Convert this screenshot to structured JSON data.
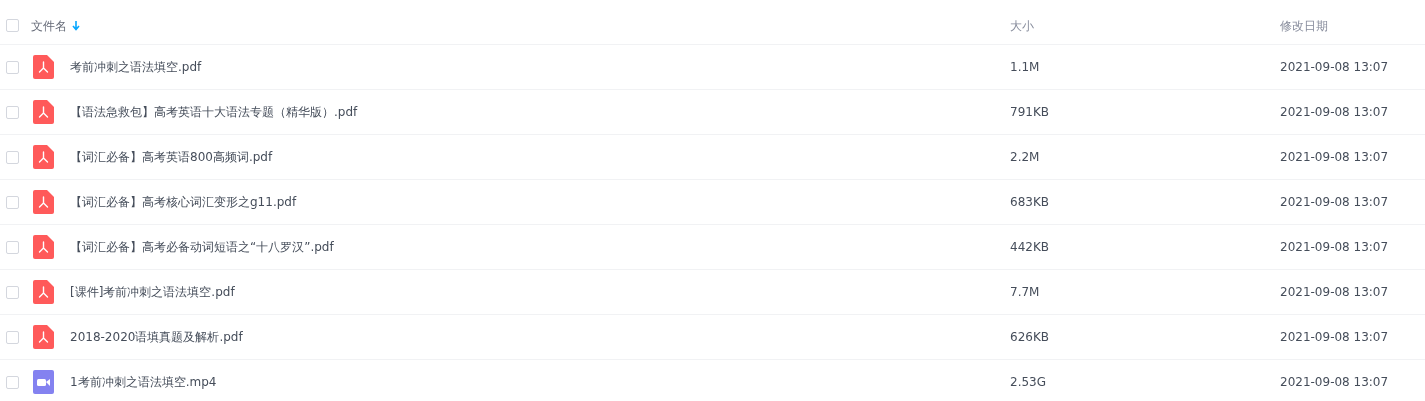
{
  "table": {
    "columns": [
      {
        "label": "文件名",
        "sorted": true
      },
      {
        "label": "大小",
        "sorted": false
      },
      {
        "label": "修改日期",
        "sorted": false
      }
    ],
    "all_checked": false,
    "rows": [
      {
        "kind": "pdf",
        "name": "考前冲刺之语法填空.pdf",
        "size": "1.1M",
        "modified": "2021-09-08 13:07",
        "checked": false
      },
      {
        "kind": "pdf",
        "name": "【语法急救包】高考英语十大语法专题（精华版）.pdf",
        "size": "791KB",
        "modified": "2021-09-08 13:07",
        "checked": false
      },
      {
        "kind": "pdf",
        "name": "【词汇必备】高考英语800高频词.pdf",
        "size": "2.2M",
        "modified": "2021-09-08 13:07",
        "checked": false
      },
      {
        "kind": "pdf",
        "name": "【词汇必备】高考核心词汇变形之g11.pdf",
        "size": "683KB",
        "modified": "2021-09-08 13:07",
        "checked": false
      },
      {
        "kind": "pdf",
        "name": "【词汇必备】高考必备动词短语之“十八罗汉”.pdf",
        "size": "442KB",
        "modified": "2021-09-08 13:07",
        "checked": false
      },
      {
        "kind": "pdf",
        "name": "[课件]考前冲刺之语法填空.pdf",
        "size": "7.7M",
        "modified": "2021-09-08 13:07",
        "checked": false
      },
      {
        "kind": "pdf",
        "name": "2018-2020语填真题及解析.pdf",
        "size": "626KB",
        "modified": "2021-09-08 13:07",
        "checked": false
      },
      {
        "kind": "video",
        "name": "1考前冲刺之语法填空.mp4",
        "size": "2.53G",
        "modified": "2021-09-08 13:07",
        "checked": false
      }
    ]
  }
}
